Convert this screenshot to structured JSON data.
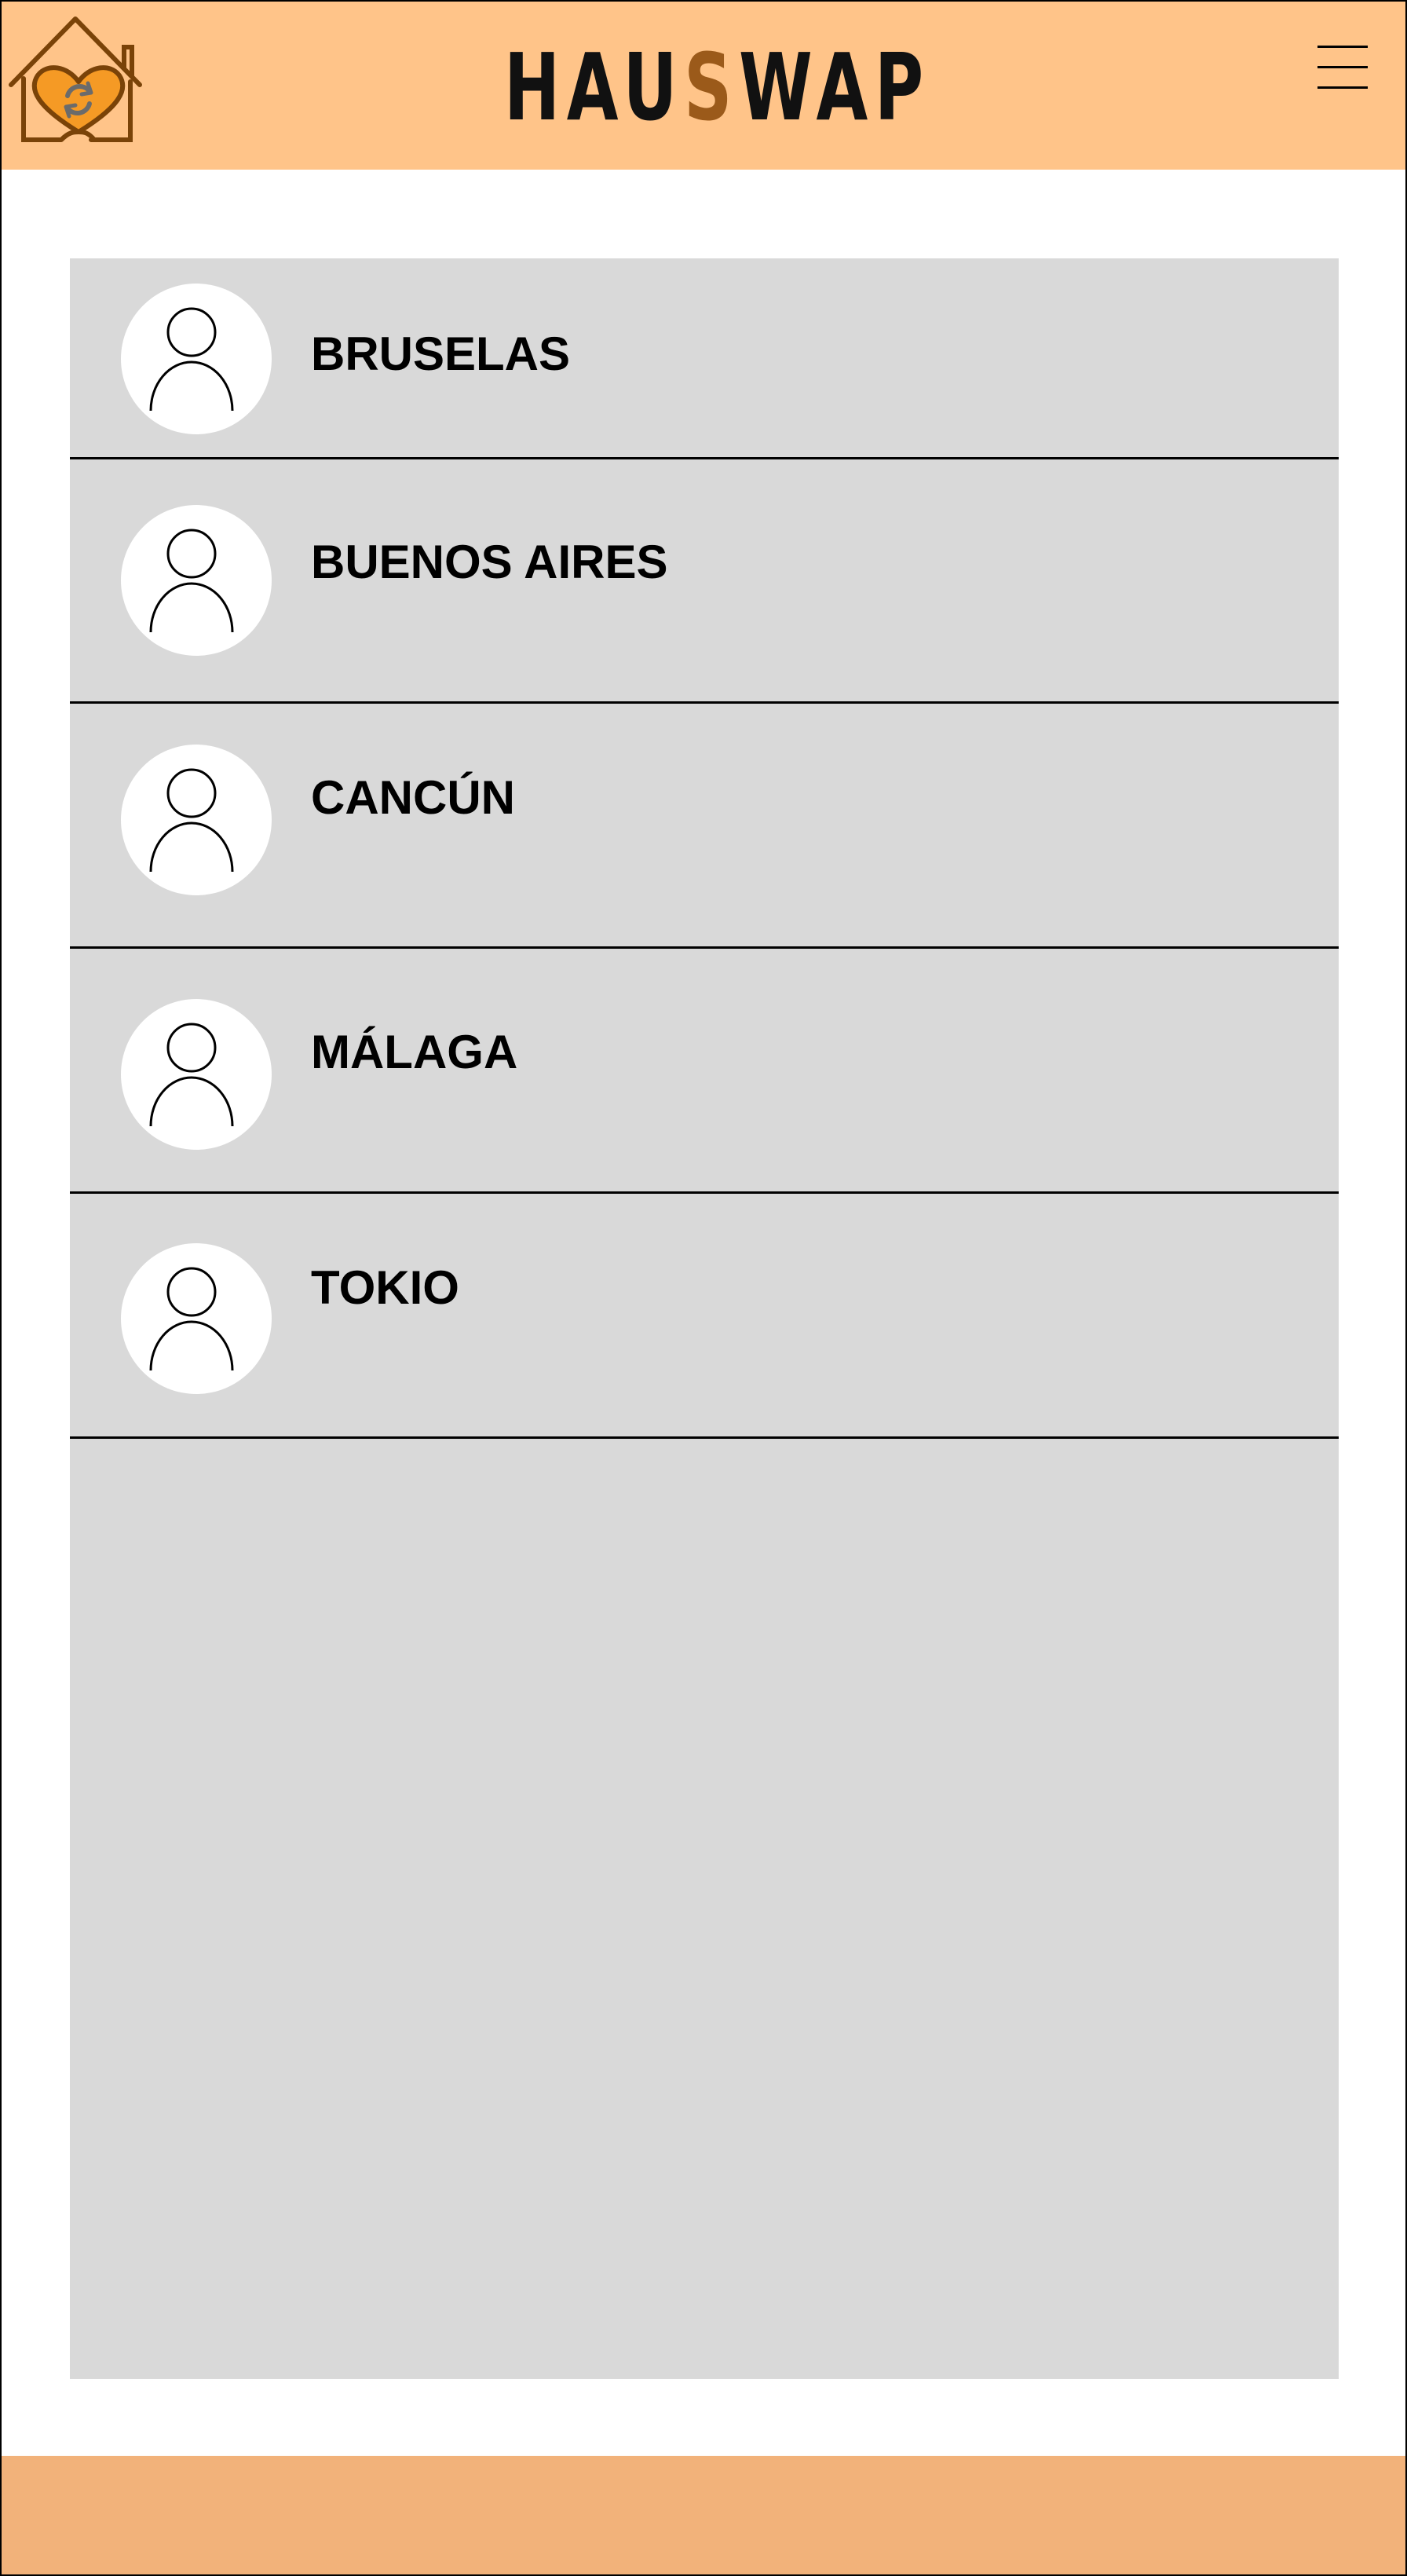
{
  "header": {
    "brand_prefix": "HAU",
    "brand_accent": "S",
    "brand_suffix": "WAP",
    "logo_icon": "house-heart-logo-icon",
    "menu_icon": "hamburger-menu-icon"
  },
  "colors": {
    "header_background": "#ffc489",
    "footer_background": "#f2b27a",
    "brand_accent": "#9b5a1a",
    "list_background": "#d9d9d9"
  },
  "destinations": [
    {
      "name": "BRUSELAS",
      "icon": "user-avatar-icon"
    },
    {
      "name": "BUENOS AIRES",
      "icon": "user-avatar-icon"
    },
    {
      "name": "CANCÚN",
      "icon": "user-avatar-icon"
    },
    {
      "name": "MÁLAGA",
      "icon": "user-avatar-icon"
    },
    {
      "name": "TOKIO",
      "icon": "user-avatar-icon"
    }
  ]
}
